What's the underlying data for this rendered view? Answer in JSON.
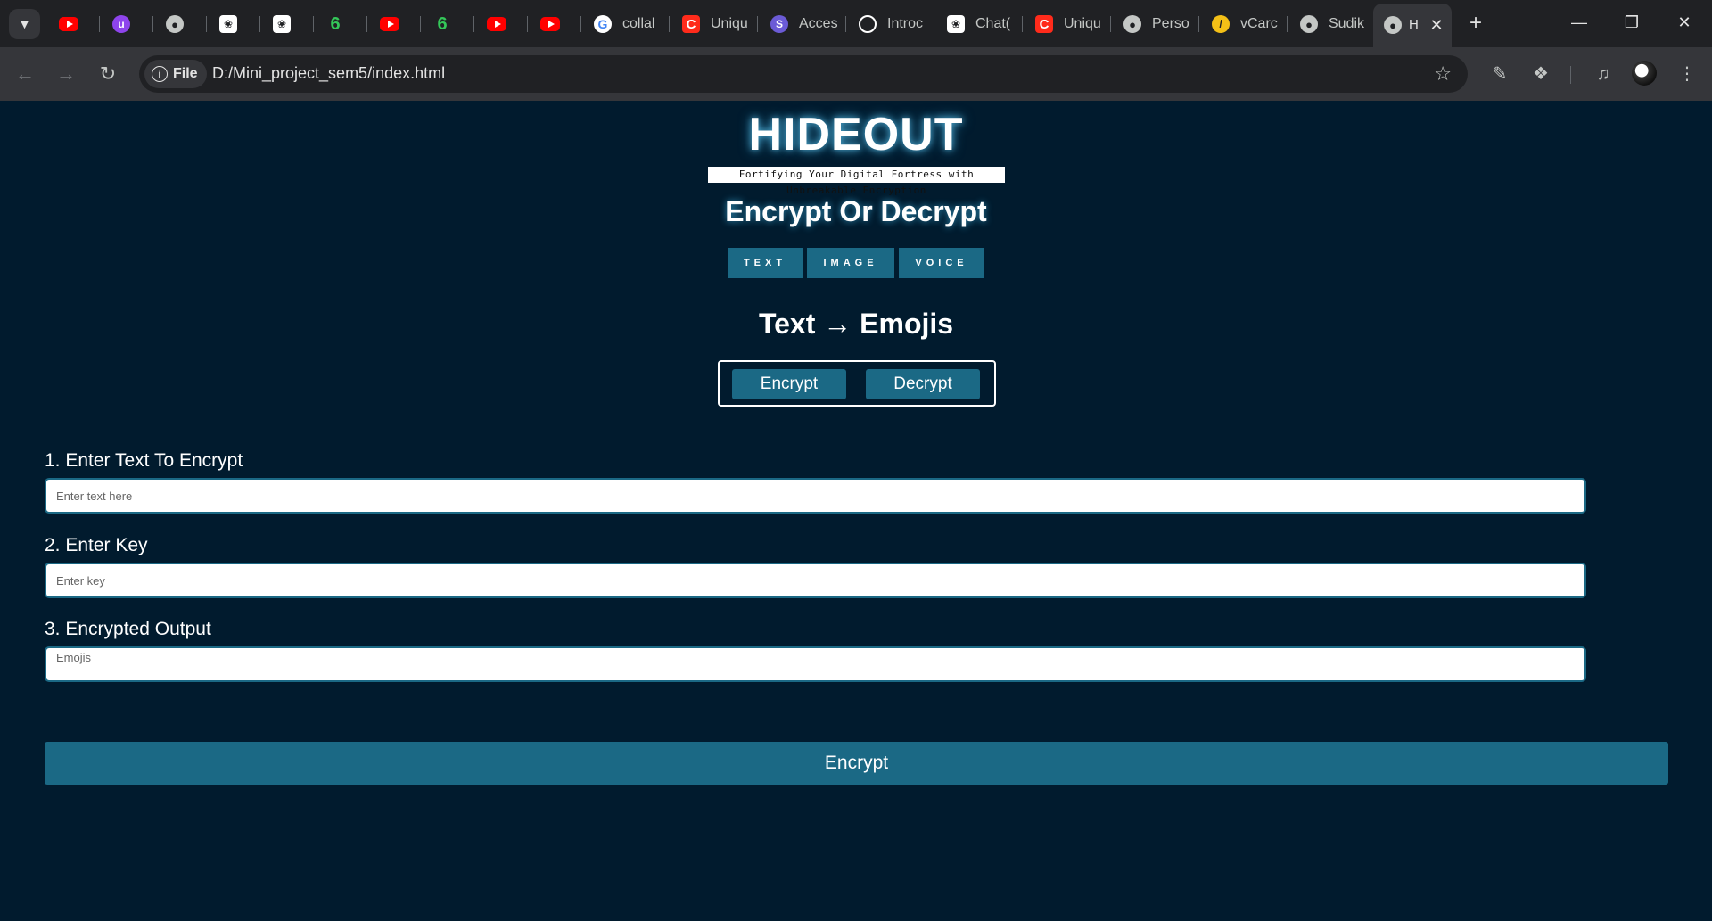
{
  "browser": {
    "tabs": [
      {
        "icon": "youtube-icon",
        "label": ""
      },
      {
        "icon": "purple-u-icon",
        "label": ""
      },
      {
        "icon": "globe-icon",
        "label": ""
      },
      {
        "icon": "openai-icon",
        "label": ""
      },
      {
        "icon": "openai-icon",
        "label": ""
      },
      {
        "icon": "green-6-icon",
        "label": ""
      },
      {
        "icon": "youtube-icon",
        "label": ""
      },
      {
        "icon": "green-6-icon",
        "label": ""
      },
      {
        "icon": "youtube-icon",
        "label": ""
      },
      {
        "icon": "youtube-icon",
        "label": ""
      },
      {
        "icon": "google-icon",
        "label": "collal"
      },
      {
        "icon": "coursera-icon",
        "label": "Uniqu"
      },
      {
        "icon": "slant-s-icon",
        "label": "Acces"
      },
      {
        "icon": "chatgpt-icon",
        "label": "Introc"
      },
      {
        "icon": "chatgpt-icon",
        "label": "Chat("
      },
      {
        "icon": "coursera-icon",
        "label": "Uniqu"
      },
      {
        "icon": "globe-icon",
        "label": "Perso"
      },
      {
        "icon": "yellow-slash-icon",
        "label": "vCarc"
      },
      {
        "icon": "globe-icon",
        "label": "Sudik"
      }
    ],
    "active_tab_label": "H",
    "new_tab_label": "+",
    "chip_label": "File",
    "url": "D:/Mini_project_sem5/index.html",
    "colors": {
      "tabstrip": "#202124",
      "toolbar": "#35363a"
    }
  },
  "app": {
    "brand": "HIDEOUT",
    "tagline": "Fortifying Your Digital Fortress with Unbreakable Encryption",
    "heading": "Encrypt Or Decrypt",
    "modes": [
      "TEXT",
      "IMAGE",
      "VOICE"
    ],
    "subheading": "Text → Emojis",
    "toggle": {
      "encrypt": "Encrypt",
      "decrypt": "Decrypt"
    },
    "fields": [
      {
        "label": "1. Enter Text To Encrypt",
        "placeholder": "Enter text here",
        "value": ""
      },
      {
        "label": "2. Enter Key",
        "placeholder": "Enter key",
        "value": ""
      },
      {
        "label": "3. Encrypted Output",
        "placeholder": "Emojis",
        "value": ""
      }
    ],
    "submit_label": "Encrypt",
    "colors": {
      "background": "#011b2e",
      "accent": "#1b6985",
      "text": "#ffffff"
    }
  }
}
